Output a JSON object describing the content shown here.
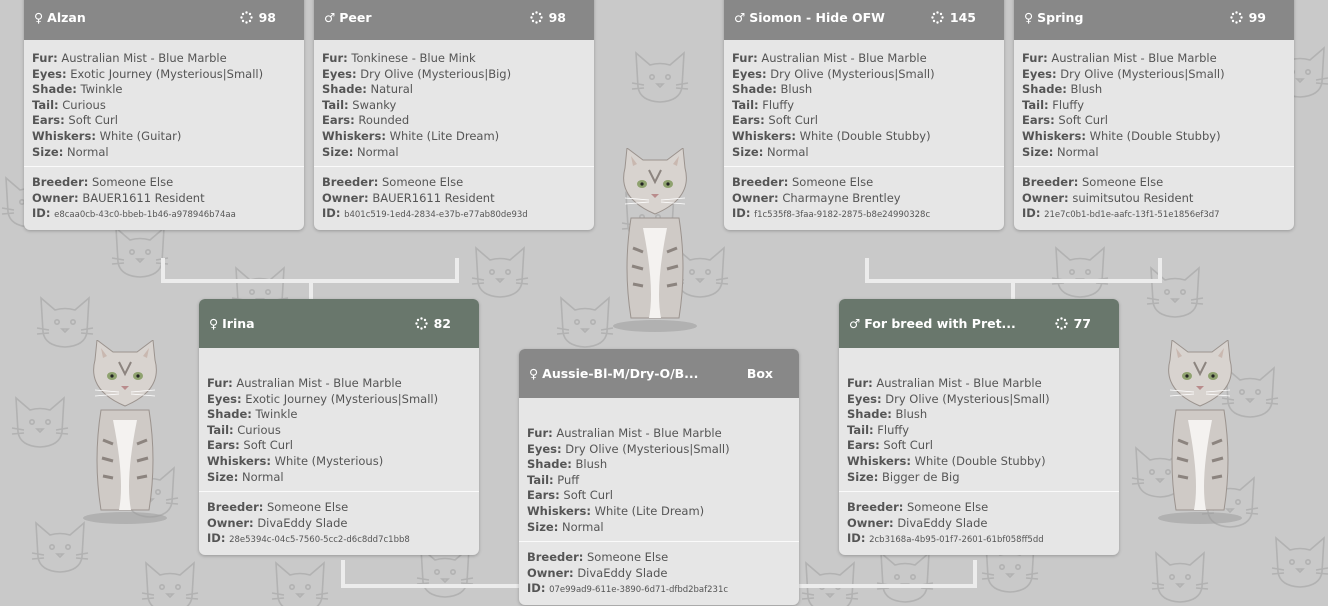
{
  "cards": {
    "alzan": {
      "sex": "♀",
      "name": "Alzan",
      "count": "98",
      "fur": "Australian Mist - Blue Marble",
      "eyes": "Exotic Journey (Mysterious|Small)",
      "shade": "Twinkle",
      "tail": "Curious",
      "ears": "Soft Curl",
      "whiskers": "White (Guitar)",
      "size": "Normal",
      "breeder": "Someone Else",
      "owner": "BAUER1611 Resident",
      "id": "e8caa0cb-43c0-bbeb-1b46-a978946b74aa"
    },
    "peer": {
      "sex": "♂",
      "name": "Peer",
      "count": "98",
      "fur": "Tonkinese - Blue Mink",
      "eyes": "Dry Olive (Mysterious|Big)",
      "shade": "Natural",
      "tail": "Swanky",
      "ears": "Rounded",
      "whiskers": "White (Lite Dream)",
      "size": "Normal",
      "breeder": "Someone Else",
      "owner": "BAUER1611 Resident",
      "id": "b401c519-1ed4-2834-e37b-e77ab80de93d"
    },
    "siomon": {
      "sex": "♂",
      "name": "Siomon - Hide OFW",
      "count": "145",
      "fur": "Australian Mist - Blue Marble",
      "eyes": "Dry Olive (Mysterious|Small)",
      "shade": "Blush",
      "tail": "Fluffy",
      "ears": "Soft Curl",
      "whiskers": "White (Double Stubby)",
      "size": "Normal",
      "breeder": "Someone Else",
      "owner": "Charmayne Brentley",
      "id": "f1c535f8-3faa-9182-2875-b8e24990328c"
    },
    "spring": {
      "sex": "♀",
      "name": "Spring",
      "count": "99",
      "fur": "Australian Mist - Blue Marble",
      "eyes": "Dry Olive (Mysterious|Small)",
      "shade": "Blush",
      "tail": "Fluffy",
      "ears": "Soft Curl",
      "whiskers": "White (Double Stubby)",
      "size": "Normal",
      "breeder": "Someone Else",
      "owner": "suimitsutou Resident",
      "id": "21e7c0b1-bd1e-aafc-13f1-51e1856ef3d7"
    },
    "irina": {
      "sex": "♀",
      "name": "Irina",
      "count": "82",
      "fur": "Australian Mist - Blue Marble",
      "eyes": "Exotic Journey (Mysterious|Small)",
      "shade": "Twinkle",
      "tail": "Curious",
      "ears": "Soft Curl",
      "whiskers": "White (Mysterious)",
      "size": "Normal",
      "breeder": "Someone Else",
      "owner": "DivaEddy Slade",
      "id": "28e5394c-04c5-7560-5cc2-d6c8dd7c1bb8"
    },
    "forbreed": {
      "sex": "♂",
      "name": "For breed with Pret...",
      "count": "77",
      "fur": "Australian Mist - Blue Marble",
      "eyes": "Dry Olive (Mysterious|Small)",
      "shade": "Blush",
      "tail": "Fluffy",
      "ears": "Soft Curl",
      "whiskers": "White (Double Stubby)",
      "size": "Bigger de Big",
      "breeder": "Someone Else",
      "owner": "DivaEddy Slade",
      "id": "2cb3168a-4b95-01f7-2601-61bf058ff5dd"
    },
    "aussie": {
      "sex": "♀",
      "name": "Aussie-Bl-M/Dry-O/B...",
      "count": "Box",
      "fur": "Australian Mist - Blue Marble",
      "eyes": "Dry Olive (Mysterious|Small)",
      "shade": "Blush",
      "tail": "Puff",
      "ears": "Soft Curl",
      "whiskers": "White (Lite Dream)",
      "size": "Normal",
      "breeder": "Someone Else",
      "owner": "DivaEddy Slade",
      "id": "07e99ad9-611e-3890-6d71-dfbd2baf231c"
    }
  },
  "labels": {
    "fur": "Fur:",
    "eyes": "Eyes:",
    "shade": "Shade:",
    "tail": "Tail:",
    "ears": "Ears:",
    "whiskers": "Whiskers:",
    "size": "Size:",
    "breeder": "Breeder:",
    "owner": "Owner:",
    "id": "ID:"
  },
  "icons": {
    "count": "spinner-dots-icon",
    "cat": "cat-figure-icon",
    "background": "cat-face-outline-pattern"
  },
  "colors": {
    "header_grey": "#888888",
    "header_green": "#69776c",
    "card_bg": "#e6e6e6",
    "page_bg": "#c9c9c9"
  }
}
